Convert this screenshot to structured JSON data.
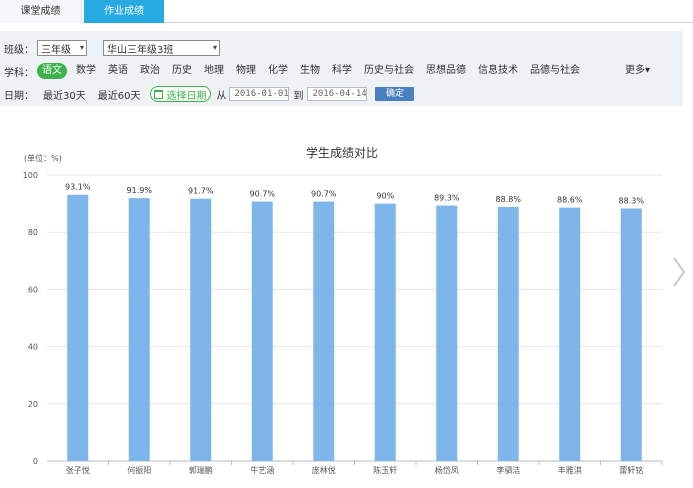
{
  "tabs": [
    {
      "label": "课堂成绩",
      "active": false
    },
    {
      "label": "作业成绩",
      "active": true
    }
  ],
  "filters": {
    "class_label": "班级：",
    "grade_value": "三年级",
    "class_value": "华山三年级3班",
    "subject_label": "学科：",
    "subjects": [
      "语文",
      "数学",
      "英语",
      "政治",
      "历史",
      "地理",
      "物理",
      "化学",
      "生物",
      "科学",
      "历史与社会",
      "思想品德",
      "信息技术",
      "品德与社会"
    ],
    "active_subject": "语文",
    "more_label": "更多",
    "date_label": "日期：",
    "last30": "最近30天",
    "last60": "最近60天",
    "pick_date": "选择日期",
    "from_label": "从",
    "start_date": "2016-01-01",
    "to_label": "到",
    "end_date": "2016-04-14",
    "confirm_label": "确定"
  },
  "colors": {
    "tab_active": "#27a9e1",
    "subject_active": "#3cb34a",
    "bar": "#7eb5ea",
    "confirm": "#4a7fc1"
  },
  "chart_data": {
    "type": "bar",
    "title": "学生成绩对比",
    "ylabel": "(单位：%)",
    "categories": [
      "张子悦",
      "何振阳",
      "郭瑞鹏",
      "牛艺涵",
      "庞林悦",
      "陈玉轩",
      "杨岱凤",
      "李驷洁",
      "丰雅淇",
      "蕾轩铭"
    ],
    "values": [
      93.1,
      91.9,
      91.7,
      90.7,
      90.7,
      90,
      89.3,
      88.8,
      88.6,
      88.3
    ],
    "data_labels": [
      "93.1%",
      "91.9%",
      "91.7%",
      "90.7%",
      "90.7%",
      "90%",
      "89.3%",
      "88.8%",
      "88.6%",
      "88.3%"
    ],
    "ylim": [
      0,
      100
    ],
    "yticks": [
      0,
      20,
      40,
      60,
      80,
      100
    ],
    "grid": true,
    "legend": "none"
  },
  "icons": {
    "dropdown": "chevron-down-icon",
    "calendar": "calendar-icon",
    "next": "chevron-right-icon"
  }
}
